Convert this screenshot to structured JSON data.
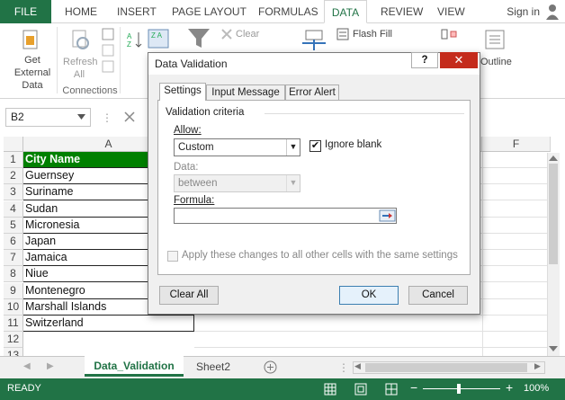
{
  "ribbon_tabs": [
    "FILE",
    "HOME",
    "INSERT",
    "PAGE LAYOUT",
    "FORMULAS",
    "DATA",
    "REVIEW",
    "VIEW"
  ],
  "signin": "Sign in",
  "ribbon": {
    "get_external_data": "Get External Data",
    "refresh_all": "Refresh All",
    "connections": "Connections",
    "clear": "Clear",
    "flash_fill": "Flash Fill",
    "outline": "Outline"
  },
  "name_box": "B2",
  "column_headers": [
    "A",
    "F"
  ],
  "rows": [
    "1",
    "2",
    "3",
    "4",
    "5",
    "6",
    "7",
    "8",
    "9",
    "10",
    "11",
    "12",
    "13"
  ],
  "cells": [
    "City Name",
    "Guernsey",
    "Suriname",
    "Sudan",
    "Micronesia",
    "Japan",
    "Jamaica",
    "Niue",
    "Montenegro",
    "Marshall Islands",
    "Switzerland"
  ],
  "sheets": [
    "Data_Validation",
    "Sheet2"
  ],
  "status": {
    "mode": "READY",
    "zoom": "100%"
  },
  "dialog": {
    "title": "Data Validation",
    "help": "?",
    "tabs": [
      "Settings",
      "Input Message",
      "Error Alert"
    ],
    "section": "Validation criteria",
    "allow_label": "Allow:",
    "allow_value": "Custom",
    "ignore_blank": "Ignore blank",
    "data_label": "Data:",
    "data_value": "between",
    "formula_label": "Formula:",
    "formula_value": "",
    "apply_all": "Apply these changes to all other cells with the same settings",
    "clear_all": "Clear All",
    "ok": "OK",
    "cancel": "Cancel"
  },
  "colors": {
    "excel_green": "#217346",
    "header_fill": "#008000"
  }
}
